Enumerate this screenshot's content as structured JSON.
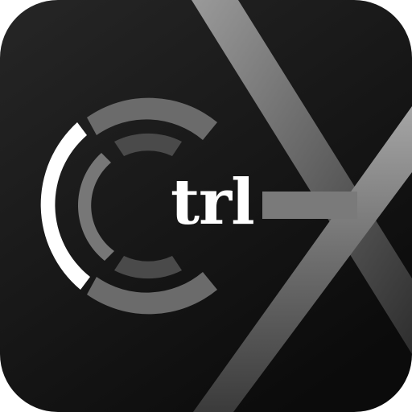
{
  "icon": {
    "wordmark": "trl",
    "colors": {
      "background_top": "#262626",
      "background_bottom": "#0b0b0b",
      "x_stroke_light": "#a3a3a3",
      "x_stroke_dark": "#3a3a3a",
      "arc_outer": "#6b6b6b",
      "arc_inner": "#4a4a4a",
      "arc_highlight": "#ffffff",
      "arc_mid": "#777777",
      "wordmark": "#ffffff"
    }
  }
}
